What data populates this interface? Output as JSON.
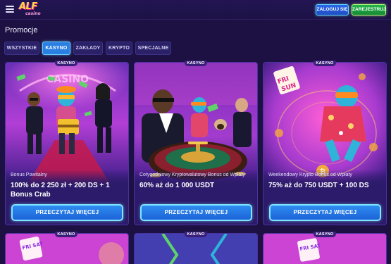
{
  "header": {
    "logo_main": "ALF",
    "logo_sub": "casino",
    "login_label": "ZALOGUJ SIĘ",
    "register_label": "ZAREJESTRUJ"
  },
  "page": {
    "title": "Promocje"
  },
  "tabs": [
    {
      "label": "WSZYSTKIE",
      "active": false
    },
    {
      "label": "KASYNO",
      "active": true
    },
    {
      "label": "ZAKŁADY",
      "active": false
    },
    {
      "label": "KRYPTO",
      "active": false
    },
    {
      "label": "SPECJALNE",
      "active": false
    }
  ],
  "cards": [
    {
      "badge": "KASYNO",
      "subtitle": "Bonus Powitalny",
      "title": "100% do 2 250 zł + 200 DS + 1 Bonus Crab",
      "button": "PRZECZYTAJ WIĘCEJ"
    },
    {
      "badge": "KASYNO",
      "subtitle": "Cotygodniowy Kryptowalutowy Bonus od Wpłaty",
      "title": "60% aż do 1 000 USDT",
      "button": "PRZECZYTAJ WIĘCEJ"
    },
    {
      "badge": "KASYNO",
      "subtitle": "Weekendowy Krypto Bonus od Wpłaty",
      "title": "75% aż do 750 USDT + 100 DS",
      "button": "PRZECZYTAJ WIĘCEJ"
    }
  ],
  "cards_row2": [
    {
      "badge": "KASYNO"
    },
    {
      "badge": "KASYNO"
    },
    {
      "badge": "KASYNO"
    }
  ],
  "art_text": {
    "card1_sign": "CASINO",
    "card3_sign_top": "FRI",
    "card3_sign_bottom": "SUN",
    "row2_card1_sign": "FRI SAT",
    "row2_card3_sign": "FRI SAT"
  },
  "colors": {
    "background": "#1c1142",
    "accent_blue": "#2d8cf0",
    "accent_green": "#22b44a",
    "card_bg": "#2c1b6a"
  }
}
